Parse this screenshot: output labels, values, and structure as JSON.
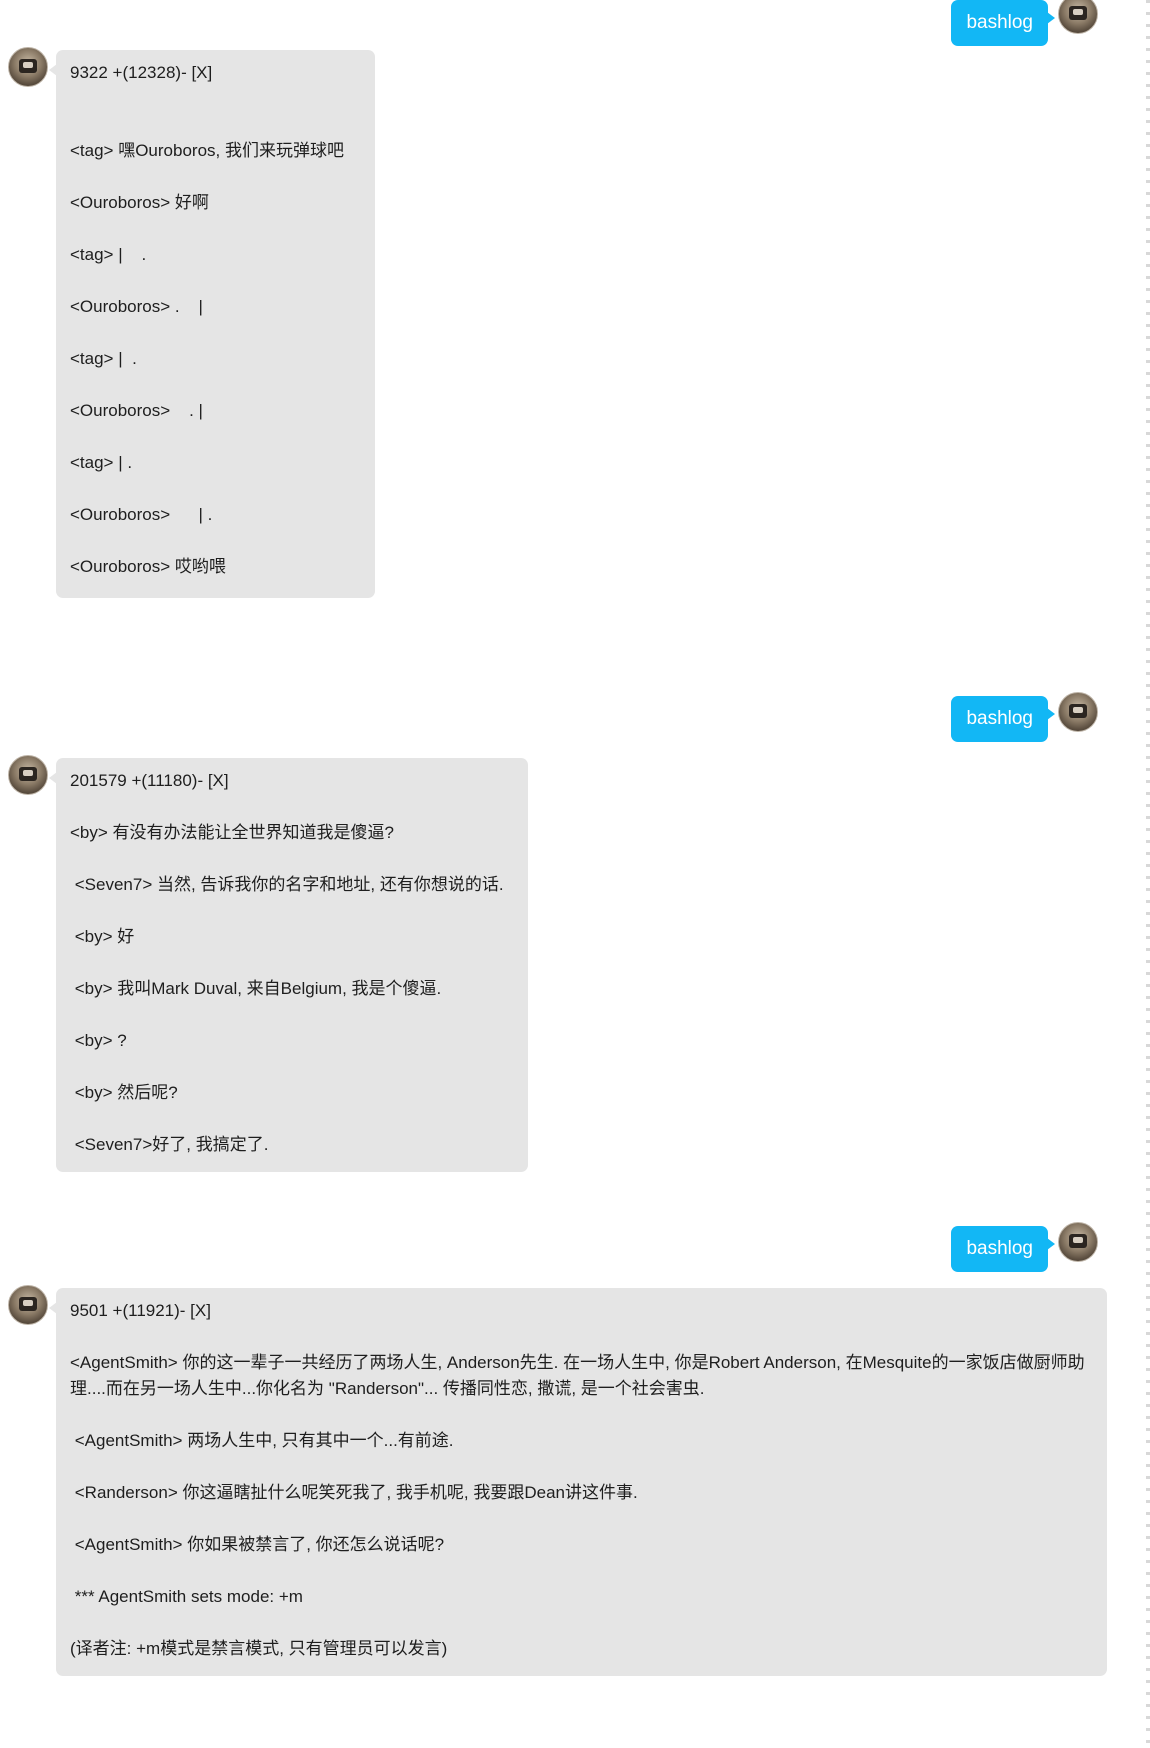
{
  "colors": {
    "outgoing_bubble": "#12b7f5",
    "incoming_bubble": "#e5e5e5",
    "background": "#ffffff"
  },
  "icons": {
    "avatar": "user-avatar-icon"
  },
  "messages": [
    {
      "direction": "outgoing",
      "text": "bashlog"
    },
    {
      "direction": "incoming",
      "header": "9322 +(12328)- [X]",
      "lines": [
        "<tag> 嘿Ouroboros, 我们来玩弹球吧",
        "<Ouroboros> 好啊",
        "<tag> |    .",
        "<Ouroboros> .    |",
        "<tag> |  .",
        "<Ouroboros>    . |",
        "<tag> | .",
        "<Ouroboros>      | .",
        "<Ouroboros> 哎哟喂"
      ]
    },
    {
      "direction": "outgoing",
      "text": "bashlog"
    },
    {
      "direction": "incoming",
      "header": "201579 +(11180)- [X]",
      "lines": [
        "<by> 有没有办法能让全世界知道我是傻逼?",
        " <Seven7> 当然, 告诉我你的名字和地址, 还有你想说的话.",
        " <by> 好",
        " <by> 我叫Mark Duval, 来自Belgium, 我是个傻逼.",
        " <by> ?",
        " <by> 然后呢?",
        " <Seven7>好了, 我搞定了."
      ]
    },
    {
      "direction": "outgoing",
      "text": "bashlog"
    },
    {
      "direction": "incoming",
      "header": "9501 +(11921)- [X]",
      "lines": [
        "<AgentSmith> 你的这一辈子一共经历了两场人生, Anderson先生. 在一场人生中, 你是Robert Anderson, 在Mesquite的一家饭店做厨师助理....而在另一场人生中...你化名为 \"Randerson\"... 传播同性恋, 撒谎, 是一个社会害虫.",
        " <AgentSmith> 两场人生中, 只有其中一个...有前途.",
        " <Randerson> 你这逼瞎扯什么呢笑死我了, 我手机呢, 我要跟Dean讲这件事.",
        " <AgentSmith> 你如果被禁言了, 你还怎么说话呢?",
        " *** AgentSmith sets mode: +m",
        "(译者注: +m模式是禁言模式, 只有管理员可以发言)"
      ]
    }
  ]
}
